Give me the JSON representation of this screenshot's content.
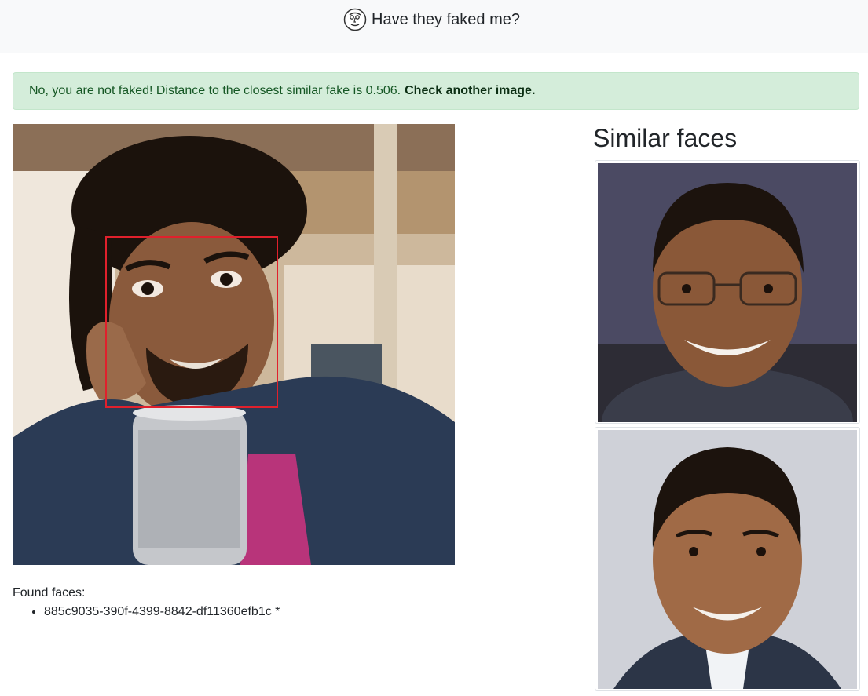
{
  "navbar": {
    "title": "Have they faked me?",
    "logo_icon": "cartoon-face-logo-icon"
  },
  "alert": {
    "message": "No, you are not faked! Distance to the closest similar fake is 0.506.",
    "link_text": "Check another image.",
    "color": "#155724",
    "background": "#d4edda"
  },
  "uploaded_image": {
    "face_box_color": "#e0202c"
  },
  "found_faces": {
    "label": "Found faces:",
    "items": [
      "885c9035-390f-4399-8842-df11360efb1c *"
    ]
  },
  "similar": {
    "title": "Similar faces"
  }
}
